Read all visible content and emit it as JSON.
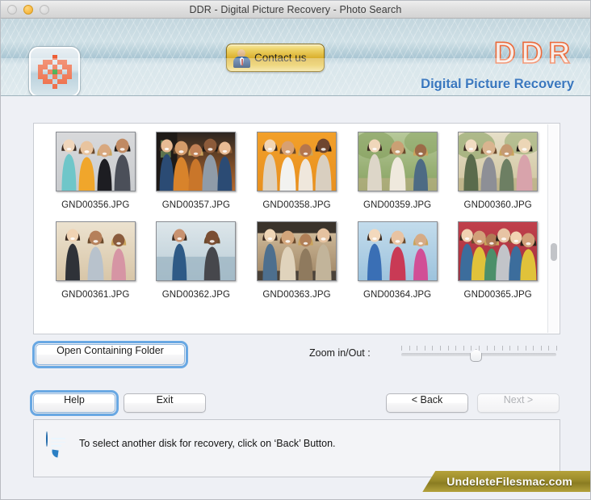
{
  "window": {
    "title": "DDR - Digital Picture Recovery - Photo Search",
    "traffic_lights": [
      "close",
      "minimize",
      "zoom"
    ]
  },
  "banner": {
    "app_icon_name": "pixel-flower-icon",
    "contact_button": "Contact us",
    "contact_icon_name": "person-icon",
    "brand_title": "DDR",
    "brand_subtitle": "Digital Picture Recovery",
    "brand_title_color": "#ec6a3a",
    "brand_subtitle_color": "#1c63b5"
  },
  "gallery": {
    "scrollbar": "vertical-scrollbar",
    "items": [
      {
        "filename": "GND00356.JPG",
        "bg": "#d8d9db",
        "theme": "four-women-laughing-grey"
      },
      {
        "filename": "GND00357.JPG",
        "bg": "#c0672a",
        "theme": "group-indoors-orange-wall"
      },
      {
        "filename": "GND00358.JPG",
        "bg": "#f2a02a",
        "theme": "four-friends-orange-backdrop"
      },
      {
        "filename": "GND00359.JPG",
        "bg": "#b9c89a",
        "theme": "three-women-outdoors-trees"
      },
      {
        "filename": "GND00360.JPG",
        "bg": "#e3ddc6",
        "theme": "four-women-walking-field"
      },
      {
        "filename": "GND00361.JPG",
        "bg": "#e6dcc9",
        "theme": "three-friends-hat-outdoors"
      },
      {
        "filename": "GND00362.JPG",
        "bg": "#cfd9de",
        "theme": "two-men-beach-sunset"
      },
      {
        "filename": "GND00363.JPG",
        "bg": "#cbb79a",
        "theme": "friends-in-car-road-trip"
      },
      {
        "filename": "GND00364.JPG",
        "bg": "#bcd6e8",
        "theme": "three-women-winter-colorful"
      },
      {
        "filename": "GND00365.JPG",
        "bg": "#bc3b46",
        "theme": "six-friends-selfie-red-wall"
      }
    ]
  },
  "controls": {
    "open_folder_label": "Open Containing Folder",
    "zoom_label": "Zoom in/Out :",
    "zoom_slider": {
      "ticks": 21,
      "value_percent": 48
    }
  },
  "buttons": {
    "help": "Help",
    "exit": "Exit",
    "back": "< Back",
    "next": "Next >",
    "next_disabled": true
  },
  "status": {
    "icon_name": "speech-bubble-icon",
    "message": "To select another disk for recovery, click on ‘Back’ Button."
  },
  "watermark": {
    "text": "UndeleteFilesmac.com",
    "color": "#9c8c2b"
  }
}
